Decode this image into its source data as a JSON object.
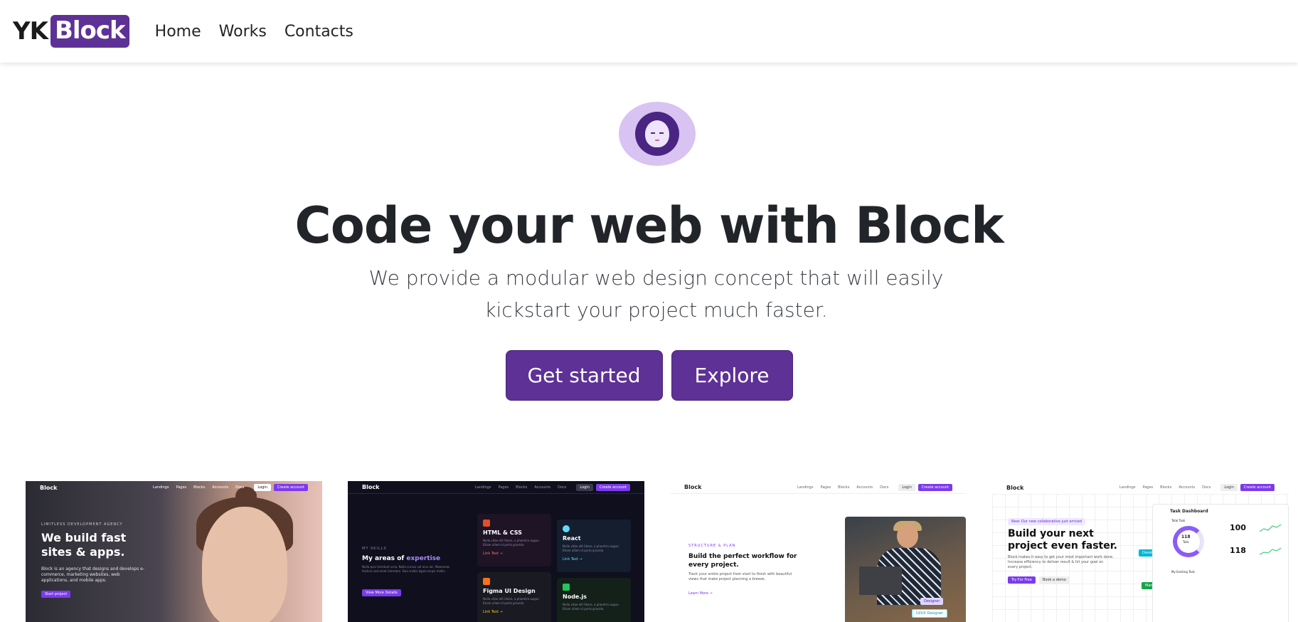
{
  "brand": {
    "prefix": "YK",
    "name": "Block"
  },
  "nav": {
    "links": [
      "Home",
      "Works",
      "Contacts"
    ]
  },
  "hero": {
    "title": "Code your web with Block",
    "subtitle": "We provide a modular web design concept that will easily kickstart your project much faster.",
    "primary_button": "Get started",
    "secondary_button": "Explore"
  },
  "colors": {
    "accent": "#5e3196",
    "avatar_bg": "#d8c3f2"
  },
  "cards": [
    {
      "logo": "Block",
      "menu": [
        "Landings",
        "Pages",
        "Blocks",
        "Accounts",
        "Docs"
      ],
      "login": "Login",
      "create": "Create account",
      "kicker": "LIMITLESS DEVELOPMENT AGENCY",
      "heading": "We build fast sites & apps.",
      "text": "Block is an agency that designs and develops e-commerce, marketing websites, web applications, and mobile apps.",
      "cta": "Start project"
    },
    {
      "logo": "Block",
      "menu": [
        "Landings",
        "Pages",
        "Blocks",
        "Accounts",
        "Docs"
      ],
      "login": "Login",
      "create": "Create account",
      "kicker": "MY SKILLS",
      "heading_a": "My areas of ",
      "heading_b": "expertise",
      "text": "Nulla quis tincidunt urna. Nulla cursus vel arcu lac. Maecenas facilisis sed amet interdum. Duis mollis ligula turpis mollis.",
      "cta": "View More Details",
      "tiles": [
        {
          "title": "HTML & CSS",
          "text": "Nulla vitae elit libero, a pharetra augue. Etiam ullam id porta gravida.",
          "link": "Link Text →"
        },
        {
          "title": "React",
          "text": "Nulla vitae elit libero, a pharetra augue. Etiam ullam id porta gravida.",
          "link": "Link Text →"
        },
        {
          "title": "Figma UI Design",
          "text": "Nulla vitae elit libero, a pharetra augue. Etiam ullam id porta gravida.",
          "link": "Link Text →"
        },
        {
          "title": "Node.js",
          "text": "Nulla vitae elit libero, a pharetra augue. Etiam ullam id porta gravida.",
          "link": "Link Text →"
        }
      ]
    },
    {
      "logo": "Block",
      "menu": [
        "Landings",
        "Pages",
        "Blocks",
        "Accounts",
        "Docs"
      ],
      "login": "Login",
      "create": "Create account",
      "kicker": "STRUCTURE & PLAN",
      "heading": "Build the perfect workflow for every project.",
      "text": "Track your entire project from start to finish with beautiful views that make project planning a breeze.",
      "cta": "Learn More →",
      "tag1": "Designer",
      "tag2": "UI/UX Designer"
    },
    {
      "logo": "Block",
      "menu": [
        "Landings",
        "Pages",
        "Blocks",
        "Accounts",
        "Docs"
      ],
      "login": "Login",
      "create": "Create account",
      "badge": "New: Our new collaborative just arrived",
      "heading": "Build your next project even faster.",
      "text": "Block makes it easy to get your most important work done. Increase efficiency to deliver result & hit your goal on every project.",
      "cta": "Try For Free",
      "cta2": "Book a demo",
      "dashboard_title": "Task Dashboard",
      "total_task": "Total Task",
      "ring_value": "118",
      "ring_label": "Task",
      "stat1": "100",
      "stat2": "118",
      "list_title": "My Existing Task",
      "developer_tag": "Developer",
      "manager_tag": "Manager"
    }
  ]
}
